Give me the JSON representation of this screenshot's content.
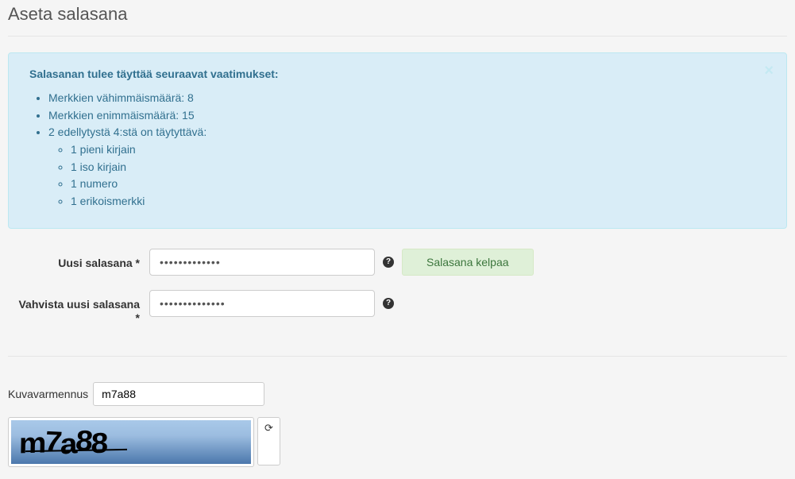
{
  "page": {
    "title": "Aseta salasana"
  },
  "alert": {
    "title": "Salasanan tulee täyttää seuraavat vaatimukset:",
    "items": [
      "Merkkien vähimmäismäärä: 8",
      "Merkkien enimmäismäärä: 15",
      "2 edellytystä 4:stä on täytyttävä:"
    ],
    "subitems": [
      "1 pieni kirjain",
      "1 iso kirjain",
      "1 numero",
      "1 erikoismerkki"
    ],
    "close": "×"
  },
  "form": {
    "new_password_label": "Uusi salasana *",
    "new_password_value": "•••••••••••••",
    "confirm_label_line1": "Vahvista uusi salasana",
    "confirm_label_line2": "*",
    "confirm_value": "••••••••••••••",
    "help_glyph": "?",
    "status_ok": "Salasana kelpaa"
  },
  "captcha": {
    "label": "Kuvavarmennus",
    "input_value": "m7a88",
    "image_text": "m7a88",
    "refresh_glyph": "⟳"
  }
}
